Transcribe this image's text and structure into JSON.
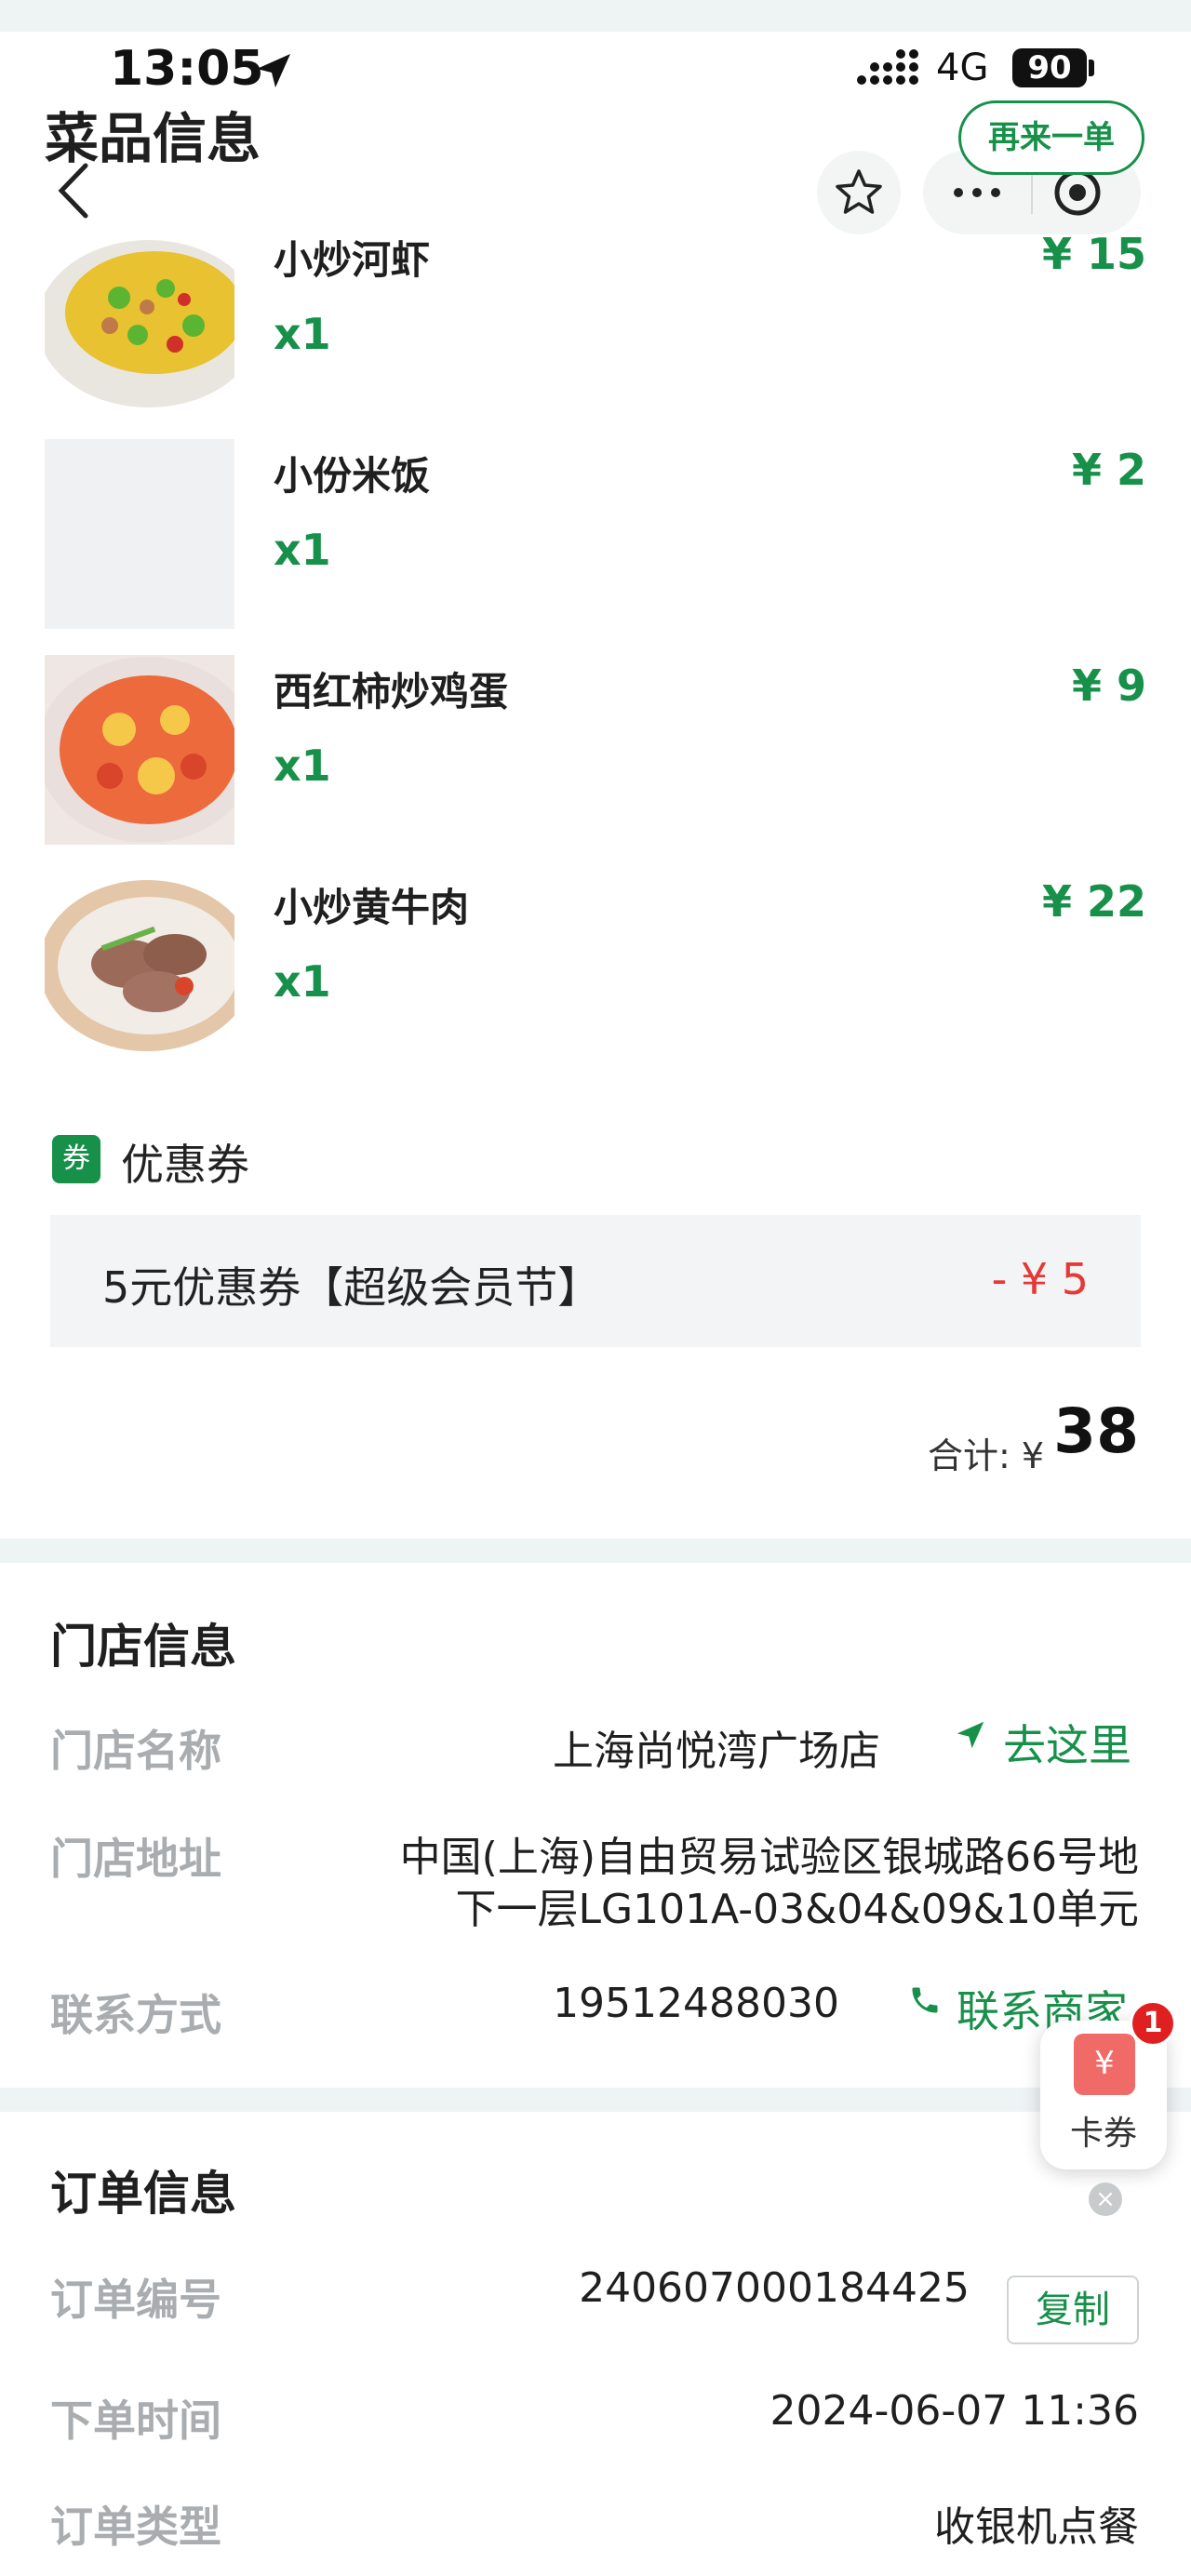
{
  "status_bar": {
    "time": "13:05",
    "network": "4G",
    "battery": "90"
  },
  "nav": {
    "title": "菜品信息",
    "reorder_label": "再来一单"
  },
  "dishes": [
    {
      "name": "小炒河虾",
      "qty": "x1",
      "price": "¥ 15"
    },
    {
      "name": "小份米饭",
      "qty": "x1",
      "price": "¥ 2"
    },
    {
      "name": "西红柿炒鸡蛋",
      "qty": "x1",
      "price": "¥ 9"
    },
    {
      "name": "小炒黄牛肉",
      "qty": "x1",
      "price": "¥ 22"
    }
  ],
  "coupon": {
    "tag": "券",
    "title": "优惠券",
    "name": "5元优惠券【超级会员节】",
    "amount": "- ¥ 5"
  },
  "total": {
    "label": "合计: ¥",
    "value": "38"
  },
  "store": {
    "title": "门店信息",
    "name_label": "门店名称",
    "name": "上海尚悦湾广场店",
    "navigate_label": "去这里",
    "address_label": "门店地址",
    "address_line1": "中国(上海)自由贸易试验区银城路66号地",
    "address_line2": "下一层LG101A-03&04&09&10单元",
    "contact_label": "联系方式",
    "phone": "19512488030",
    "contact_merchant_label": "联系商家"
  },
  "order": {
    "title": "订单信息",
    "number_label": "订单编号",
    "number": "240607000184425",
    "copy_label": "复制",
    "time_label": "下单时间",
    "time": "2024-06-07 11:36",
    "type_label": "订单类型",
    "type": "收银机点餐"
  },
  "float_widget": {
    "icon": "¥",
    "label": "卡券",
    "badge": "1",
    "close": "×"
  },
  "colors": {
    "accent": "#17904a",
    "discount": "#e53935",
    "badge": "#e02020"
  }
}
